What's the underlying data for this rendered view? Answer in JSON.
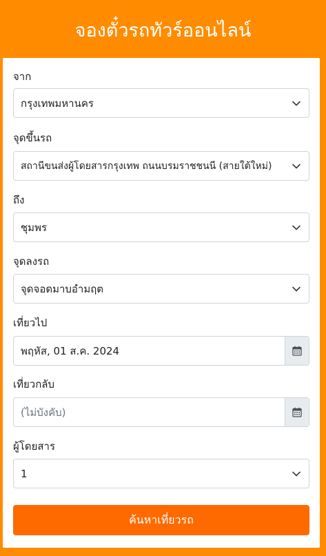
{
  "header": {
    "title": "จองตั๋วรถทัวร์ออนไลน์"
  },
  "form": {
    "from": {
      "label": "จาก",
      "value": "กรุงเทพมหานคร"
    },
    "pickup": {
      "label": "จุดขึ้นรถ",
      "value": "สถานีขนส่งผู้โดยสารกรุงเทพ ถนนบรมราชชนนี (สายใต้ใหม่)"
    },
    "to": {
      "label": "ถึง",
      "value": "ชุมพร"
    },
    "dropoff": {
      "label": "จุดลงรถ",
      "value": "จุดจอดมาบอำมฤต"
    },
    "depart": {
      "label": "เที่ยวไป",
      "value": "พฤหัส, 01 ส.ค. 2024"
    },
    "return": {
      "label": "เที่ยวกลับ",
      "placeholder": "(ไม่บังคับ)"
    },
    "passengers": {
      "label": "ผู้โดยสาร",
      "value": "1"
    },
    "search_label": "ค้นหาเที่ยวรถ"
  },
  "icons": {
    "dropdown": "chevron-down-icon",
    "calendar": "calendar-icon"
  },
  "colors": {
    "background": "#ff8c00",
    "button": "#ff6a00"
  }
}
